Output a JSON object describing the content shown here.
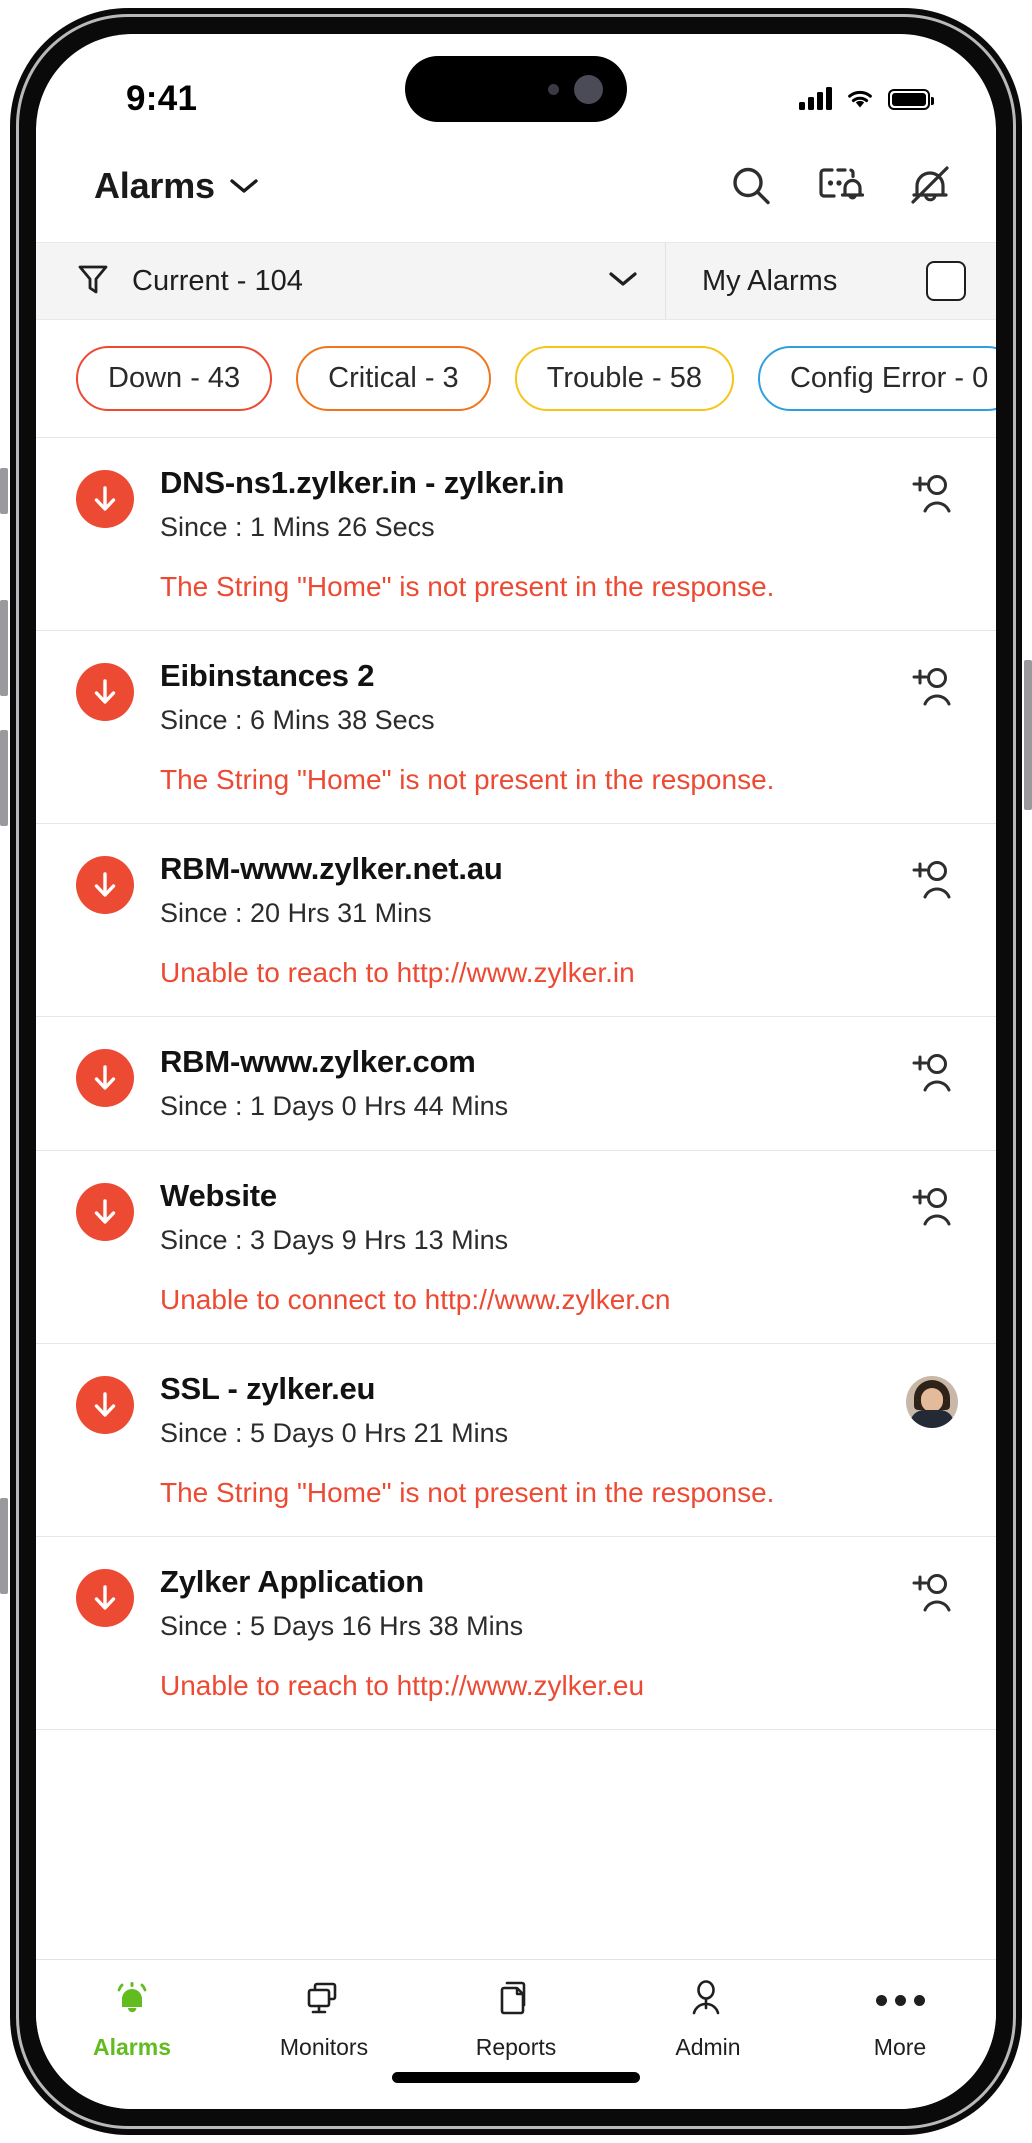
{
  "status_bar": {
    "time": "9:41",
    "signal_icon": "cellular-signal-icon",
    "wifi_icon": "wifi-icon",
    "battery_icon": "battery-full-icon"
  },
  "header": {
    "title": "Alarms",
    "title_chevron_icon": "chevron-down-icon",
    "actions": [
      {
        "name": "search-icon",
        "label": "Search"
      },
      {
        "name": "server-alert-icon",
        "label": "Alert Server"
      },
      {
        "name": "bell-off-icon",
        "label": "Mute Notifications"
      }
    ]
  },
  "filter_bar": {
    "filter_icon": "funnel-icon",
    "selected_filter": "Current - 104",
    "dropdown_icon": "chevron-down-icon",
    "my_alarms_label": "My Alarms",
    "my_alarms_checked": false
  },
  "chips": [
    {
      "label": "Down - 43",
      "color": "#ec4a33"
    },
    {
      "label": "Critical - 3",
      "color": "#f0751c"
    },
    {
      "label": "Trouble - 58",
      "color": "#f5c518"
    },
    {
      "label": "Config Error - 0",
      "color": "#2f9fe0"
    }
  ],
  "alarms": [
    {
      "severity_icon": "down-arrow-icon",
      "severity_color": "#ec4a33",
      "title": "DNS-ns1.zylker.in - zylker.in",
      "since": "Since : 1 Mins 26 Secs",
      "message": "The String \"Home\" is not present in the response.",
      "action": "assign-user-icon"
    },
    {
      "severity_icon": "down-arrow-icon",
      "severity_color": "#ec4a33",
      "title": "Eibinstances 2",
      "since": "Since : 6 Mins 38 Secs",
      "message": "The String \"Home\" is not present in the response.",
      "action": "assign-user-icon"
    },
    {
      "severity_icon": "down-arrow-icon",
      "severity_color": "#ec4a33",
      "title": "RBM-www.zylker.net.au",
      "since": "Since : 20 Hrs 31 Mins",
      "message": "Unable to reach to http://www.zylker.in",
      "action": "assign-user-icon"
    },
    {
      "severity_icon": "down-arrow-icon",
      "severity_color": "#ec4a33",
      "title": "RBM-www.zylker.com",
      "since": "Since : 1 Days 0 Hrs 44 Mins",
      "message": "",
      "action": "assign-user-icon"
    },
    {
      "severity_icon": "down-arrow-icon",
      "severity_color": "#ec4a33",
      "title": "Website",
      "since": "Since : 3 Days 9 Hrs 13 Mins",
      "message": "Unable to connect to http://www.zylker.cn",
      "action": "assign-user-icon"
    },
    {
      "severity_icon": "down-arrow-icon",
      "severity_color": "#ec4a33",
      "title": "SSL - zylker.eu",
      "since": "Since : 5 Days 0 Hrs 21 Mins",
      "message": "The String \"Home\" is not present in the response.",
      "action": "assigned-user-avatar"
    },
    {
      "severity_icon": "down-arrow-icon",
      "severity_color": "#ec4a33",
      "title": "Zylker Application",
      "since": "Since : 5 Days 16 Hrs 38 Mins",
      "message": "Unable to reach to http://www.zylker.eu",
      "action": "assign-user-icon"
    }
  ],
  "tab_bar": {
    "active_color": "#62bb1f",
    "tabs": [
      {
        "label": "Alarms",
        "icon": "bell-ringing-icon",
        "active": true
      },
      {
        "label": "Monitors",
        "icon": "monitor-icon",
        "active": false
      },
      {
        "label": "Reports",
        "icon": "document-pages-icon",
        "active": false
      },
      {
        "label": "Admin",
        "icon": "person-icon",
        "active": false
      },
      {
        "label": "More",
        "icon": "ellipsis-icon",
        "active": false
      }
    ]
  }
}
